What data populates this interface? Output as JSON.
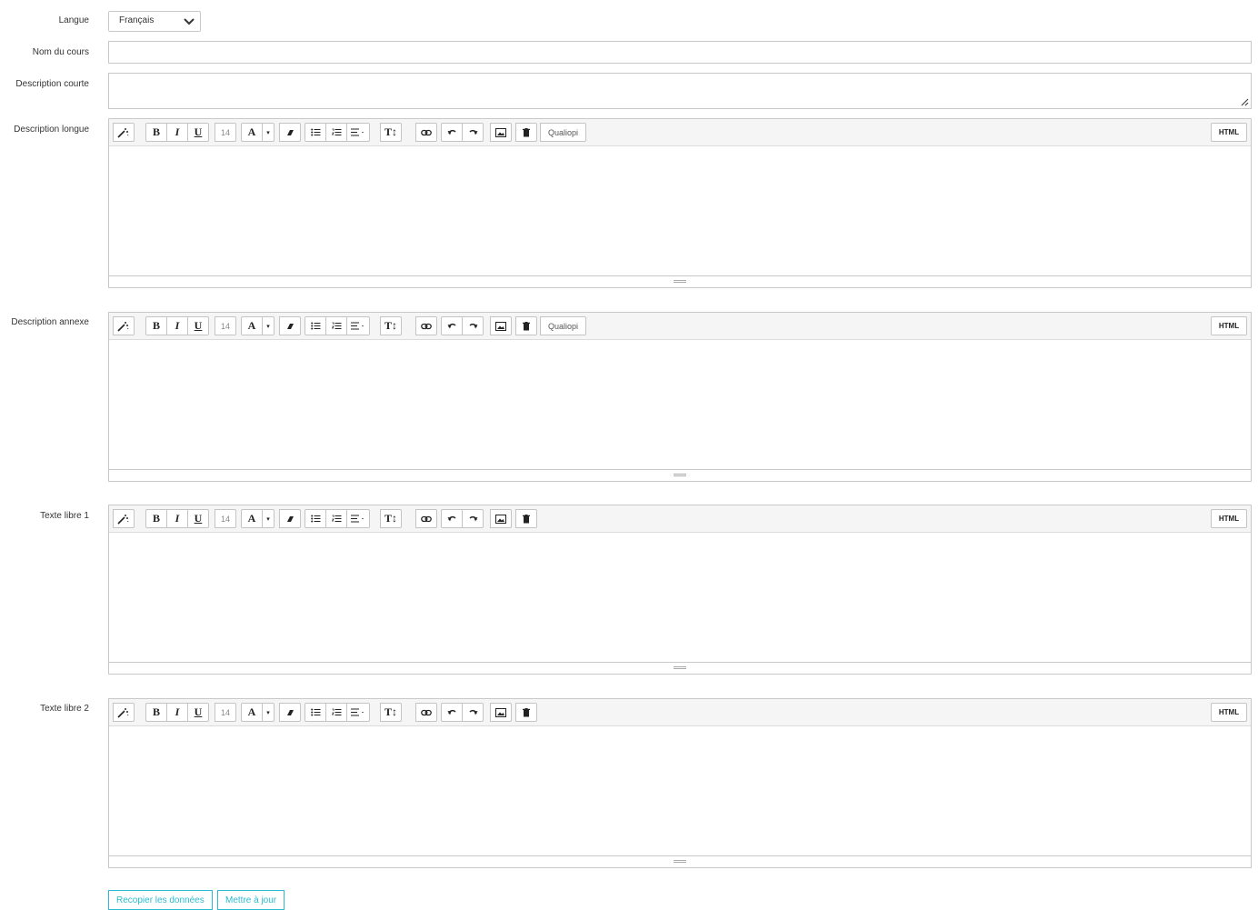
{
  "fields": {
    "langue": {
      "label": "Langue",
      "value": "Français"
    },
    "nom_du_cours": {
      "label": "Nom du cours",
      "value": ""
    },
    "description_courte": {
      "label": "Description courte",
      "value": ""
    }
  },
  "toolbar": {
    "font_size": "14",
    "color_letter": "A",
    "bold": "B",
    "italic": "I",
    "underline": "U",
    "text_height": "T↕",
    "qualiopi": "Qualiopi",
    "html": "HTML"
  },
  "editors": [
    {
      "label": "Description longue",
      "content": "",
      "has_qualiopi": true
    },
    {
      "label": "Description annexe",
      "content": "",
      "has_qualiopi": true
    },
    {
      "label": "Texte libre 1",
      "content": "",
      "has_qualiopi": false
    },
    {
      "label": "Texte libre 2",
      "content": "",
      "has_qualiopi": false
    }
  ],
  "actions": {
    "copy": "Recopier les données",
    "update": "Mettre à jour"
  },
  "colors": {
    "accent": "#2bbbd0",
    "border": "#c9c9c9",
    "toolbar_bg": "#f5f5f5"
  }
}
